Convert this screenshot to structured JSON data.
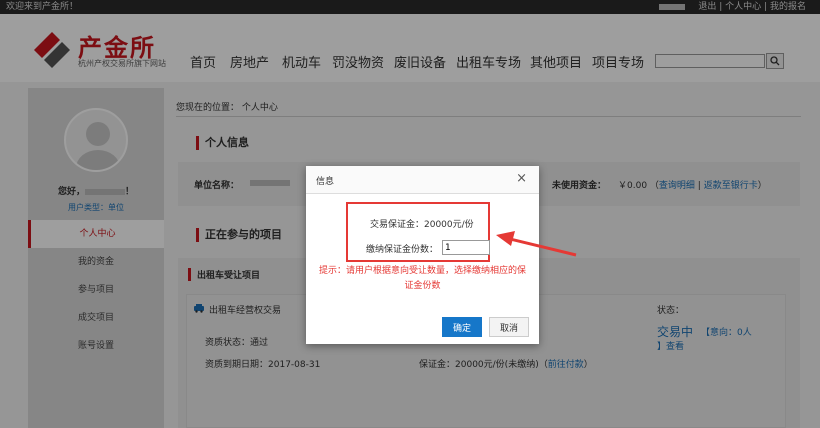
{
  "topbar": {
    "welcome": "欢迎来到产金所！",
    "logout": "退出",
    "personal_center": "个人中心",
    "my_signup": "我的报名",
    "sep": "|"
  },
  "logo": {
    "name": "产金所",
    "sub": "杭州产权交易所旗下网站",
    "brand_color": "#c8161d"
  },
  "nav": [
    "首页",
    "房地产",
    "机动车",
    "罚没物资",
    "废旧设备",
    "出租车专场",
    "其他项目",
    "项目专场"
  ],
  "search": {
    "placeholder": "",
    "icon": "search-icon"
  },
  "sidebar": {
    "hello": "您好，",
    "hello_suffix": "！",
    "user_type_label": "用户类型：",
    "user_type": "单位",
    "items": [
      "个人中心",
      "我的资金",
      "参与项目",
      "成交项目",
      "账号设置"
    ],
    "active": "个人中心"
  },
  "breadcrumb": {
    "label": "您现在的位置：",
    "current": "个人中心"
  },
  "personal_info": {
    "title": "个人信息",
    "company_label": "单位名称：",
    "unused_funds_label": "未使用资金：",
    "unused_funds": "￥0.00",
    "query_detail": "查询明细",
    "refund": "返款至银行卡"
  },
  "ongoing": {
    "title": "正在参与的项目",
    "category": "出租车受让项目",
    "project_name": "出租车经营权交易",
    "status_label": "状态：",
    "status": "交易中",
    "intent_label": "意向：",
    "intent_value": "0人",
    "view": "查看",
    "qual_status_label": "资质状态：",
    "qual_status": "通过",
    "qual_expire_label": "资质到期日期：",
    "qual_expire": "2017-08-31",
    "deposit_label": "保证金：",
    "deposit": "20000元/份(未缴纳)",
    "pay_link": "前往付款"
  },
  "dialog": {
    "title": "信息",
    "close": "×",
    "deposit_line": "交易保证金：20000元/份",
    "copies_label": "缴纳保证金份数：",
    "copies_value": "1",
    "tip": "提示：请用户根据意向受让数量，选择缴纳相应的保证金份数",
    "ok": "确定",
    "cancel": "取消",
    "accent_color": "#e53935"
  }
}
